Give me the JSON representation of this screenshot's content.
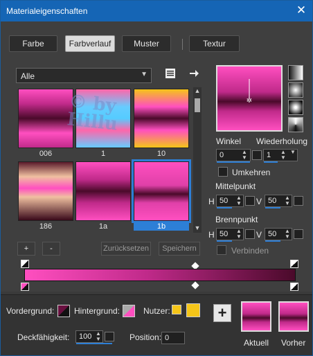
{
  "window": {
    "title": "Materialeigenschaften",
    "close_glyph": "✕"
  },
  "tabs": [
    {
      "label": "Farbe",
      "active": false
    },
    {
      "label": "Farbverlauf",
      "active": true
    },
    {
      "label": "Muster",
      "active": false
    },
    {
      "label": "Textur",
      "active": false
    }
  ],
  "library": {
    "category": "Alle",
    "thumbnails": [
      {
        "label": "006",
        "selected": false
      },
      {
        "label": "1",
        "selected": false
      },
      {
        "label": "10",
        "selected": false
      },
      {
        "label": "186",
        "selected": false
      },
      {
        "label": "1a",
        "selected": false
      },
      {
        "label": "1b",
        "selected": true
      }
    ],
    "watermark_line1": "© by",
    "watermark_line2": "Hillu"
  },
  "controls": {
    "winkel_label": "Winkel",
    "winkel_value": "0",
    "wiederholung_label": "Wiederholung",
    "wiederholung_value": "1",
    "umkehren_label": "Umkehren",
    "mittelpunkt_label": "Mittelpunkt",
    "mittel_h_label": "H",
    "mittel_h_value": "50",
    "mittel_v_label": "V",
    "mittel_v_value": "50",
    "brennpunkt_label": "Brennpunkt",
    "brenn_h_label": "H",
    "brenn_h_value": "50",
    "brenn_v_label": "V",
    "brenn_v_value": "50",
    "verbinden_label": "Verbinden"
  },
  "actions": {
    "add_label": "+",
    "remove_label": "-",
    "reset_label": "Zurücksetzen",
    "save_label": "Speichern"
  },
  "bottom": {
    "vordergrund_label": "Vordergrund:",
    "hintergrund_label": "Hintergrund:",
    "nutzer_label": "Nutzer:",
    "deckfaehigkeit_label": "Deckfähigkeit:",
    "deckfaehigkeit_value": "100",
    "position_label": "Position:",
    "position_value": "0",
    "plus_label": "+",
    "aktuell_label": "Aktuell",
    "vorher_label": "Vorher"
  },
  "colors": {
    "pink": "#ff4fc0",
    "dark": "#4a0a2a",
    "accent": "#2d7fd6",
    "user_yellow": "#f5c518"
  },
  "icons": {
    "dropdown": "chevron-down-icon",
    "library_menu": "menu-icon",
    "export": "arrow-right-icon"
  }
}
